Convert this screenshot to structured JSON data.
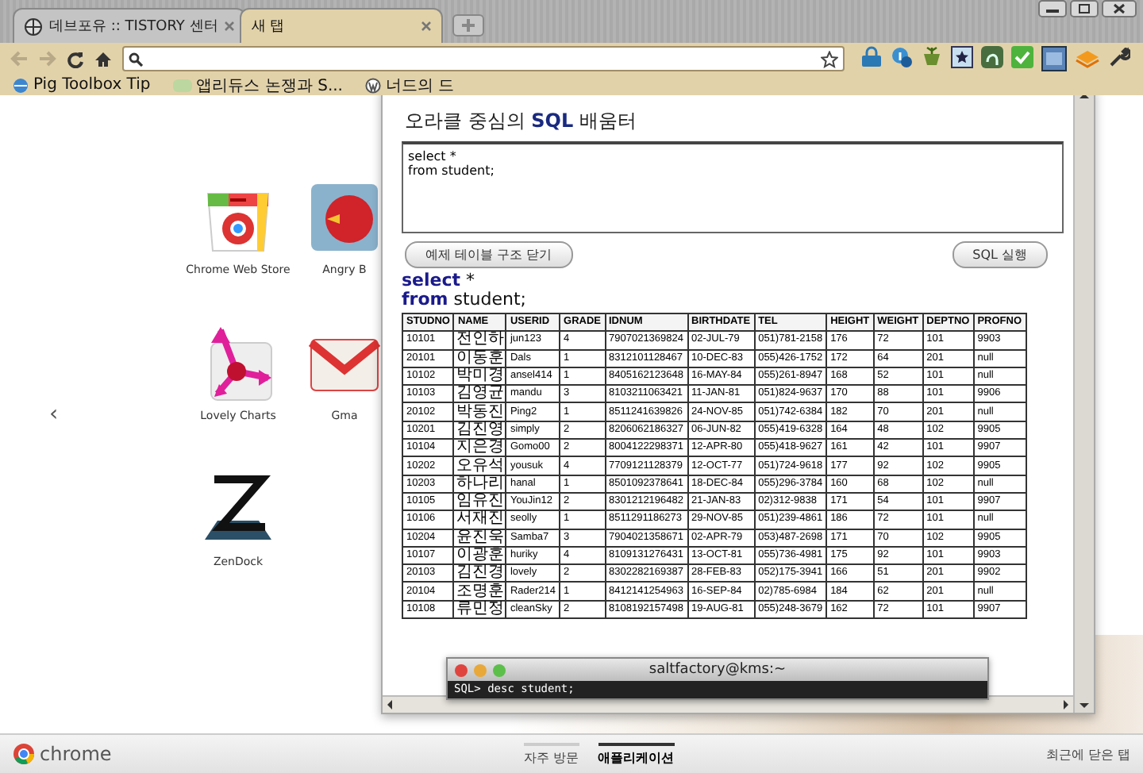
{
  "browser_tabs": [
    {
      "title": "데브포유 :: TISTORY 센터",
      "selected": false
    },
    {
      "title": "새 탭",
      "selected": true
    }
  ],
  "bookmarks": [
    "Pig Toolbox Tip",
    "앱리듀스 논쟁과 S...",
    "너드의 드"
  ],
  "apps": [
    {
      "name": "Chrome Web Store",
      "kind": "webstore"
    },
    {
      "name": "Angry B",
      "kind": "bird"
    },
    {
      "name": "Lovely Charts",
      "kind": "charts"
    },
    {
      "name": "Gma",
      "kind": "mail"
    },
    {
      "name": "ZenDock",
      "kind": "zendock"
    }
  ],
  "prev_page_arrow": "‹",
  "sql_panel": {
    "title": "오라클 중심의 **SQL** 배움터",
    "query": "select *\nfrom student;",
    "buttons": [
      "예제 테이블 구조 닫기",
      "SQL 실행"
    ],
    "echo": [
      {
        "keyword": "select",
        "rest": " *"
      },
      {
        "keyword": "from",
        "rest": " student;"
      }
    ],
    "table": {
      "columns": [
        "STUDNO",
        "NAME",
        "USERID",
        "GRADE",
        "IDNUM",
        "BIRTHDATE",
        "TEL",
        "HEIGHT",
        "WEIGHT",
        "DEPTNO",
        "PROFNO"
      ],
      "rows": [
        [
          "10101",
          "전인하",
          "jun123",
          "4",
          "7907021369824",
          "02-JUL-79",
          "051)781-2158",
          "176",
          "72",
          "101",
          "9903"
        ],
        [
          "20101",
          "이동훈",
          "Dals",
          "1",
          "8312101128467",
          "10-DEC-83",
          "055)426-1752",
          "172",
          "64",
          "201",
          "null"
        ],
        [
          "10102",
          "박미경",
          "ansel414",
          "1",
          "8405162123648",
          "16-MAY-84",
          "055)261-8947",
          "168",
          "52",
          "101",
          "null"
        ],
        [
          "10103",
          "김영균",
          "mandu",
          "3",
          "8103211063421",
          "11-JAN-81",
          "051)824-9637",
          "170",
          "88",
          "101",
          "9906"
        ],
        [
          "20102",
          "박동진",
          "Ping2",
          "1",
          "8511241639826",
          "24-NOV-85",
          "051)742-6384",
          "182",
          "70",
          "201",
          "null"
        ],
        [
          "10201",
          "김진영",
          "simply",
          "2",
          "8206062186327",
          "06-JUN-82",
          "055)419-6328",
          "164",
          "48",
          "102",
          "9905"
        ],
        [
          "10104",
          "지은경",
          "Gomo00",
          "2",
          "8004122298371",
          "12-APR-80",
          "055)418-9627",
          "161",
          "42",
          "101",
          "9907"
        ],
        [
          "10202",
          "오유석",
          "yousuk",
          "4",
          "7709121128379",
          "12-OCT-77",
          "051)724-9618",
          "177",
          "92",
          "102",
          "9905"
        ],
        [
          "10203",
          "하나리",
          "hanal",
          "1",
          "8501092378641",
          "18-DEC-84",
          "055)296-3784",
          "160",
          "68",
          "102",
          "null"
        ],
        [
          "10105",
          "임유진",
          "YouJin12",
          "2",
          "8301212196482",
          "21-JAN-83",
          "02)312-9838",
          "171",
          "54",
          "101",
          "9907"
        ],
        [
          "10106",
          "서재진",
          "seolly",
          "1",
          "8511291186273",
          "29-NOV-85",
          "051)239-4861",
          "186",
          "72",
          "101",
          "null"
        ],
        [
          "10204",
          "윤진욱",
          "Samba7",
          "3",
          "7904021358671",
          "02-APR-79",
          "053)487-2698",
          "171",
          "70",
          "102",
          "9905"
        ],
        [
          "10107",
          "이광훈",
          "huriky",
          "4",
          "8109131276431",
          "13-OCT-81",
          "055)736-4981",
          "175",
          "92",
          "101",
          "9903"
        ],
        [
          "20103",
          "김진경",
          "lovely",
          "2",
          "8302282169387",
          "28-FEB-83",
          "052)175-3941",
          "166",
          "51",
          "201",
          "9902"
        ],
        [
          "20104",
          "조명훈",
          "Rader214",
          "1",
          "8412141254963",
          "16-SEP-84",
          "02)785-6984",
          "184",
          "62",
          "201",
          "null"
        ],
        [
          "10108",
          "류민정",
          "cleanSky",
          "2",
          "8108192157498",
          "19-AUG-81",
          "055)248-3679",
          "162",
          "72",
          "101",
          "9907"
        ]
      ]
    }
  },
  "terminal": {
    "title": "saltfactory@kms:~",
    "line": "SQL> desc student;"
  },
  "bottom_bar": {
    "brand": "chrome",
    "sections": [
      {
        "label": "자주 방문",
        "selected": false
      },
      {
        "label": "애플리케이션",
        "selected": true
      }
    ],
    "recently_closed": "최근에 닫은 탭"
  }
}
